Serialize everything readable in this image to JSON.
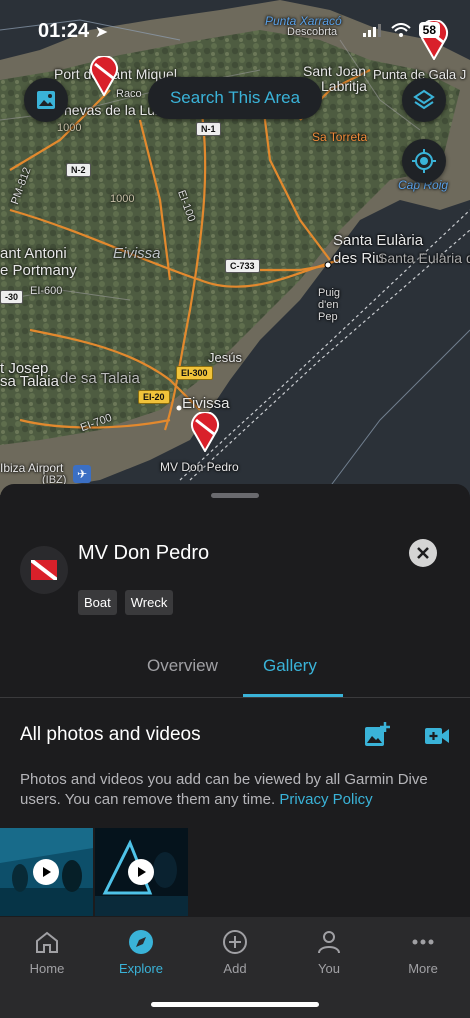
{
  "status_bar": {
    "time": "01:24",
    "battery": "58"
  },
  "map": {
    "search_button": "Search This Area",
    "labels": {
      "punta_xarraco": "Punta Xarracó",
      "descoberta": "Descobrta",
      "port_sant_miquel": "Port de Sant Miquel",
      "nevas": "nevas de la Luz",
      "raco": "Raco",
      "sant_joan": "Sant Joan",
      "labritja": "Labritja",
      "punta_gala": "Punta de Gala J",
      "sa_torreta": "Sa Torreta",
      "cap_roig": "Cap Roig",
      "eivissa_island": "Eivissa",
      "sant_antoni": "ant Antoni",
      "portmany": "e Portmany",
      "santa_eularia": "Santa Eulària",
      "des_riu": "des Riu",
      "des_riu_ghost": "Santa Eulària des Riu",
      "puig_en_pep": "Puig\nd'en\nPep",
      "jesus": "Jesús",
      "sant_josep": "t Josep",
      "sa_talaia": "sa Talaia",
      "de_sa_talaia": "de sa Talaia",
      "eivissa_town": "Eivissa",
      "ibiza_airport": "Ibiza Airport",
      "ibz": "(IBZ)",
      "mv_don_pedro": "MV Don Pedro",
      "elev_1000a": "1000",
      "elev_1000b": "1000"
    },
    "roads": {
      "n1": "N-1",
      "n2": "N-2",
      "c733": "C-733",
      "ei300": "EI-300",
      "ei20": "EI-20",
      "pm812": "PM-812",
      "ei600": "EI-600",
      "ei700": "EI-700",
      "ei100": "EI-100",
      "e30": "-30"
    }
  },
  "site": {
    "name": "MV Don Pedro",
    "tags": [
      "Boat",
      "Wreck"
    ]
  },
  "tabs": {
    "overview": "Overview",
    "gallery": "Gallery"
  },
  "gallery": {
    "title": "All photos and videos",
    "description": "Photos and videos you add can be viewed by all Garmin Dive users. You can remove them any time.",
    "privacy_link": "Privacy Policy"
  },
  "nav": {
    "home": "Home",
    "explore": "Explore",
    "add": "Add",
    "you": "You",
    "more": "More"
  },
  "colors": {
    "accent": "#3ab3d8",
    "pin": "#d9202a"
  }
}
